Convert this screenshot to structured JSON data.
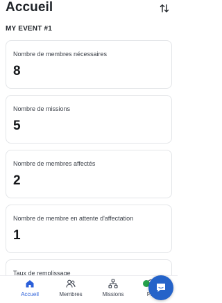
{
  "header": {
    "title": "Accueil"
  },
  "event": {
    "name": "MY EVENT #1"
  },
  "stats": [
    {
      "label": "Nombre de membres nécessaires",
      "value": "8"
    },
    {
      "label": "Nombre de missions",
      "value": "5"
    },
    {
      "label": "Nombre de membres affectés",
      "value": "2"
    },
    {
      "label": "Nombre de membre en attente d'affectation",
      "value": "1"
    },
    {
      "label": "Taux de remplissage",
      "value": ""
    }
  ],
  "nav": {
    "items": [
      {
        "label": "Accueil",
        "icon": "home-icon",
        "active": true
      },
      {
        "label": "Membres",
        "icon": "members-icon"
      },
      {
        "label": "Missions",
        "icon": "missions-icon"
      },
      {
        "label": "Pro",
        "icon": "profile-icon"
      }
    ]
  },
  "colors": {
    "accent": "#2b5fd9",
    "fab": "#2463c9",
    "badge": "#25a04a"
  }
}
